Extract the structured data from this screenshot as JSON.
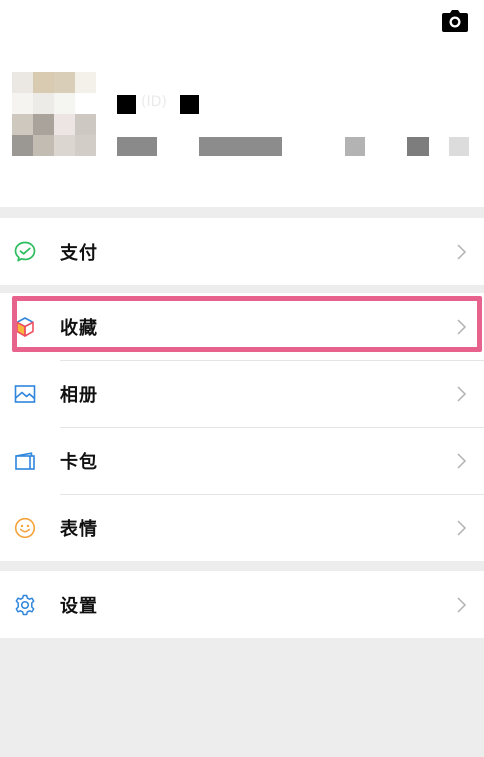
{
  "header": {
    "camera_icon": "camera-icon",
    "profile_name_ghost": "(ID)"
  },
  "menu": {
    "pay": {
      "label": "支付",
      "icon": "wechat-pay-icon",
      "icon_color": "#2dbd5f"
    },
    "favorites": {
      "label": "收藏",
      "icon": "favorites-cube-icon",
      "icon_color": "#f04f5e"
    },
    "album": {
      "label": "相册",
      "icon": "album-icon",
      "icon_color": "#2f86dd"
    },
    "cards": {
      "label": "卡包",
      "icon": "card-wallet-icon",
      "icon_color": "#2f86dd"
    },
    "stickers": {
      "label": "表情",
      "icon": "emoji-smile-icon",
      "icon_color": "#f4a23a"
    },
    "settings": {
      "label": "设置",
      "icon": "gear-icon",
      "icon_color": "#2f86dd"
    }
  },
  "colors": {
    "background": "#ededed",
    "card": "#ffffff",
    "highlight_border": "#e8628e",
    "chevron": "#b2b2b2"
  }
}
